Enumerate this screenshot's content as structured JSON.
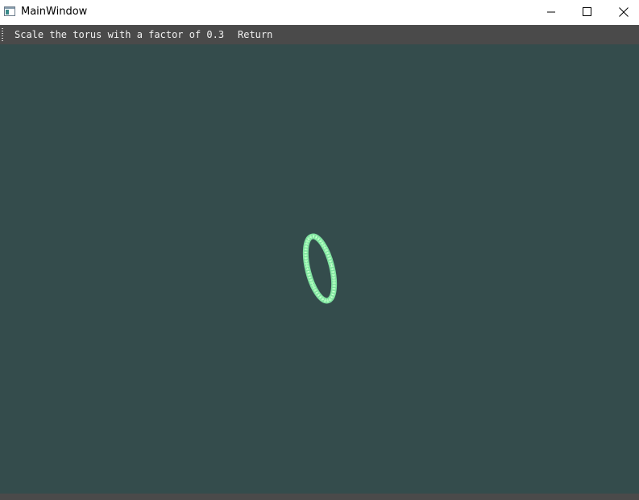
{
  "window": {
    "title": "MainWindow",
    "icon": "app-window-icon"
  },
  "title_buttons": {
    "minimize_icon": "minimize-icon",
    "maximize_icon": "maximize-icon",
    "close_icon": "close-icon"
  },
  "toolbar": {
    "actions": [
      {
        "label": "Scale the torus with a factor of 0.3"
      },
      {
        "label": "Return"
      }
    ]
  },
  "viewport": {
    "background_color": "#344c4c",
    "object": "torus",
    "object_color": "#a8ffb8"
  }
}
